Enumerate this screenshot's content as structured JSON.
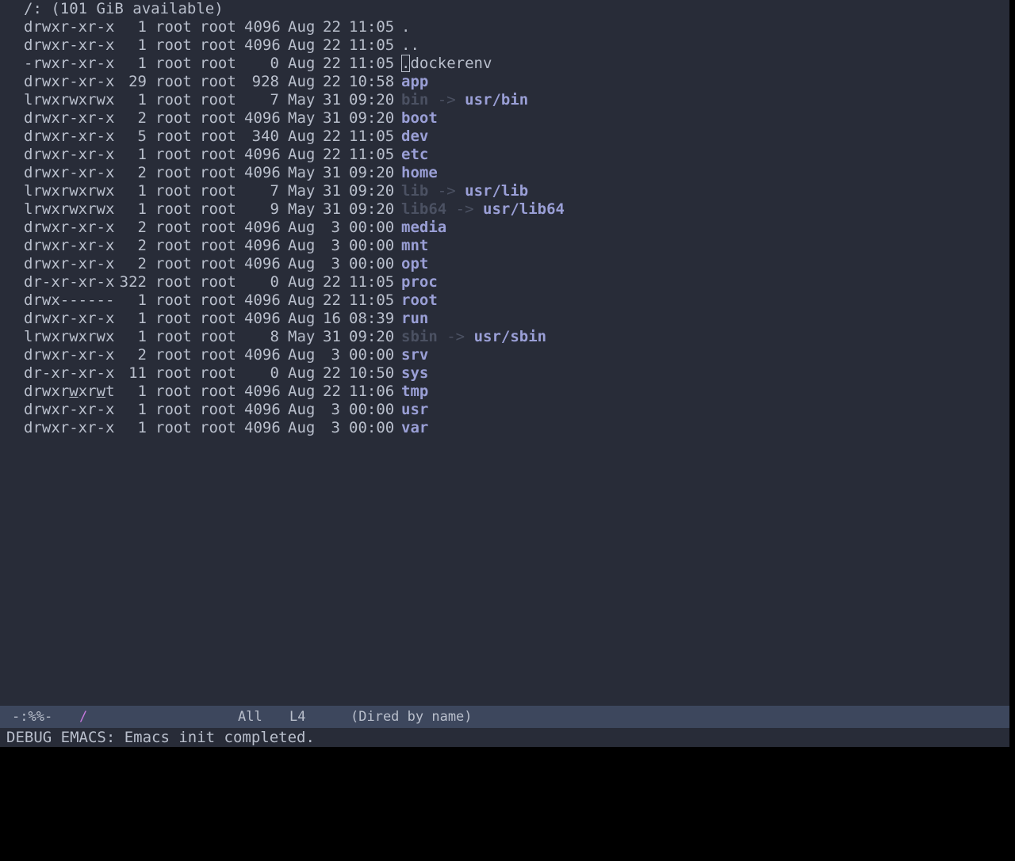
{
  "header": "/: (101 GiB available)",
  "listing": [
    {
      "perm": "drwxr-xr-x",
      "links": "1",
      "owner": "root",
      "group": "root",
      "size": "4096",
      "month": "Aug",
      "day": "22",
      "time": "11:05",
      "name": ".",
      "kind": "file"
    },
    {
      "perm": "drwxr-xr-x",
      "links": "1",
      "owner": "root",
      "group": "root",
      "size": "4096",
      "month": "Aug",
      "day": "22",
      "time": "11:05",
      "name": "..",
      "kind": "file"
    },
    {
      "perm": "-rwxr-xr-x",
      "links": "1",
      "owner": "root",
      "group": "root",
      "size": "0",
      "month": "Aug",
      "day": "22",
      "time": "11:05",
      "name": ".dockerenv",
      "kind": "file",
      "cursor": true
    },
    {
      "perm": "drwxr-xr-x",
      "links": "29",
      "owner": "root",
      "group": "root",
      "size": "928",
      "month": "Aug",
      "day": "22",
      "time": "10:58",
      "name": "app",
      "kind": "dir"
    },
    {
      "perm": "lrwxrwxrwx",
      "links": "1",
      "owner": "root",
      "group": "root",
      "size": "7",
      "month": "May",
      "day": "31",
      "time": "09:20",
      "name": "bin",
      "kind": "link",
      "target": "usr/bin"
    },
    {
      "perm": "drwxr-xr-x",
      "links": "2",
      "owner": "root",
      "group": "root",
      "size": "4096",
      "month": "May",
      "day": "31",
      "time": "09:20",
      "name": "boot",
      "kind": "dir"
    },
    {
      "perm": "drwxr-xr-x",
      "links": "5",
      "owner": "root",
      "group": "root",
      "size": "340",
      "month": "Aug",
      "day": "22",
      "time": "11:05",
      "name": "dev",
      "kind": "dir"
    },
    {
      "perm": "drwxr-xr-x",
      "links": "1",
      "owner": "root",
      "group": "root",
      "size": "4096",
      "month": "Aug",
      "day": "22",
      "time": "11:05",
      "name": "etc",
      "kind": "dir"
    },
    {
      "perm": "drwxr-xr-x",
      "links": "2",
      "owner": "root",
      "group": "root",
      "size": "4096",
      "month": "May",
      "day": "31",
      "time": "09:20",
      "name": "home",
      "kind": "dir"
    },
    {
      "perm": "lrwxrwxrwx",
      "links": "1",
      "owner": "root",
      "group": "root",
      "size": "7",
      "month": "May",
      "day": "31",
      "time": "09:20",
      "name": "lib",
      "kind": "link",
      "target": "usr/lib"
    },
    {
      "perm": "lrwxrwxrwx",
      "links": "1",
      "owner": "root",
      "group": "root",
      "size": "9",
      "month": "May",
      "day": "31",
      "time": "09:20",
      "name": "lib64",
      "kind": "link",
      "target": "usr/lib64"
    },
    {
      "perm": "drwxr-xr-x",
      "links": "2",
      "owner": "root",
      "group": "root",
      "size": "4096",
      "month": "Aug",
      "day": "3",
      "time": "00:00",
      "name": "media",
      "kind": "dir"
    },
    {
      "perm": "drwxr-xr-x",
      "links": "2",
      "owner": "root",
      "group": "root",
      "size": "4096",
      "month": "Aug",
      "day": "3",
      "time": "00:00",
      "name": "mnt",
      "kind": "dir"
    },
    {
      "perm": "drwxr-xr-x",
      "links": "2",
      "owner": "root",
      "group": "root",
      "size": "4096",
      "month": "Aug",
      "day": "3",
      "time": "00:00",
      "name": "opt",
      "kind": "dir"
    },
    {
      "perm": "dr-xr-xr-x",
      "links": "322",
      "owner": "root",
      "group": "root",
      "size": "0",
      "month": "Aug",
      "day": "22",
      "time": "11:05",
      "name": "proc",
      "kind": "dir"
    },
    {
      "perm": "drwx------",
      "links": "1",
      "owner": "root",
      "group": "root",
      "size": "4096",
      "month": "Aug",
      "day": "22",
      "time": "11:05",
      "name": "root",
      "kind": "dir"
    },
    {
      "perm": "drwxr-xr-x",
      "links": "1",
      "owner": "root",
      "group": "root",
      "size": "4096",
      "month": "Aug",
      "day": "16",
      "time": "08:39",
      "name": "run",
      "kind": "dir"
    },
    {
      "perm": "lrwxrwxrwx",
      "links": "1",
      "owner": "root",
      "group": "root",
      "size": "8",
      "month": "May",
      "day": "31",
      "time": "09:20",
      "name": "sbin",
      "kind": "link",
      "target": "usr/sbin"
    },
    {
      "perm": "drwxr-xr-x",
      "links": "2",
      "owner": "root",
      "group": "root",
      "size": "4096",
      "month": "Aug",
      "day": "3",
      "time": "00:00",
      "name": "srv",
      "kind": "dir"
    },
    {
      "perm": "dr-xr-xr-x",
      "links": "11",
      "owner": "root",
      "group": "root",
      "size": "0",
      "month": "Aug",
      "day": "22",
      "time": "10:50",
      "name": "sys",
      "kind": "dir"
    },
    {
      "perm": "drwxrwxrwt",
      "links": "1",
      "owner": "root",
      "group": "root",
      "size": "4096",
      "month": "Aug",
      "day": "22",
      "time": "11:06",
      "name": "tmp",
      "kind": "dir",
      "perm_underline": true
    },
    {
      "perm": "drwxr-xr-x",
      "links": "1",
      "owner": "root",
      "group": "root",
      "size": "4096",
      "month": "Aug",
      "day": "3",
      "time": "00:00",
      "name": "usr",
      "kind": "dir"
    },
    {
      "perm": "drwxr-xr-x",
      "links": "1",
      "owner": "root",
      "group": "root",
      "size": "4096",
      "month": "Aug",
      "day": "3",
      "time": "00:00",
      "name": "var",
      "kind": "dir"
    }
  ],
  "arrow": "->",
  "modeline": {
    "status": "-:%%-",
    "buffer": "/",
    "position": "All",
    "line": "L4",
    "mode": "(Dired by name)"
  },
  "echo": "DEBUG EMACS: Emacs init completed.",
  "colors": {
    "background": "#282c38",
    "foreground": "#b9bfcc",
    "directory": "#9a9fd6",
    "symlink_dim": "#4b5162",
    "modeline_bg": "#3d475d",
    "buffer_name": "#c678dd"
  }
}
